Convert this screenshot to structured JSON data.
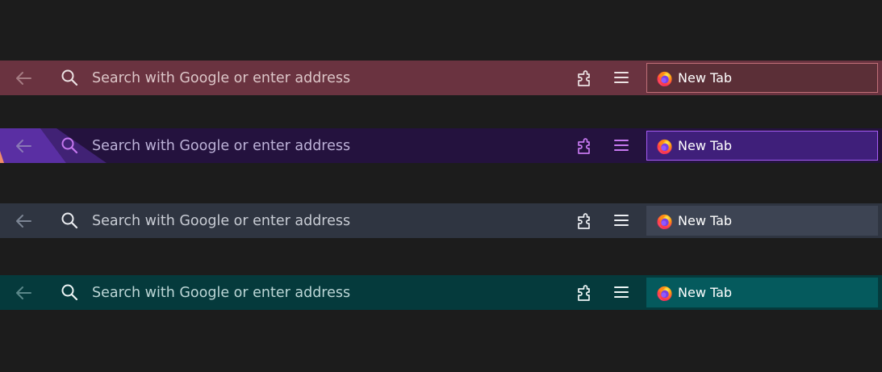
{
  "toolbars": [
    {
      "search_placeholder": "Search with Google or enter address",
      "tab_title": "New Tab",
      "colors": {
        "bar": "#6a3340",
        "text": "#dcc6c8",
        "icon": "#ece2e3",
        "back": "#a57b82",
        "tab_bg": "#5b2f37",
        "tab_border": "#c06f78",
        "tab_text": "#ffffff"
      }
    },
    {
      "search_placeholder": "Search with Google or enter address",
      "tab_title": "New Tab",
      "colors": {
        "bar": "#24123e",
        "text": "#bdb2d8",
        "icon": "#c678ef",
        "back": "#8a78b6",
        "tab_bg": "#3f1f7a",
        "tab_border": "#a55cf2",
        "tab_text": "#ffffff",
        "stripe": "#5a2fa3",
        "stripe_accent": "#f08c69"
      }
    },
    {
      "search_placeholder": "Search with Google or enter address",
      "tab_title": "New Tab",
      "colors": {
        "bar": "#2f3541",
        "text": "#c8ccd4",
        "icon": "#eceef2",
        "back": "#7c8594",
        "tab_bg": "#3d4453",
        "tab_border": "#3d4453",
        "tab_text": "#ffffff"
      }
    },
    {
      "search_placeholder": "Search with Google or enter address",
      "tab_title": "New Tab",
      "colors": {
        "bar": "#053a3c",
        "text": "#bcd6d6",
        "icon": "#eef6f6",
        "back": "#5a8789",
        "tab_bg": "#055a5d",
        "tab_border": "#055a5d",
        "tab_text": "#ffffff"
      }
    }
  ],
  "icons": {
    "back": "arrow-left-icon",
    "search": "magnifier-icon",
    "extensions": "puzzle-piece-icon",
    "menu": "hamburger-menu-icon",
    "browser": "firefox-logo-icon"
  }
}
